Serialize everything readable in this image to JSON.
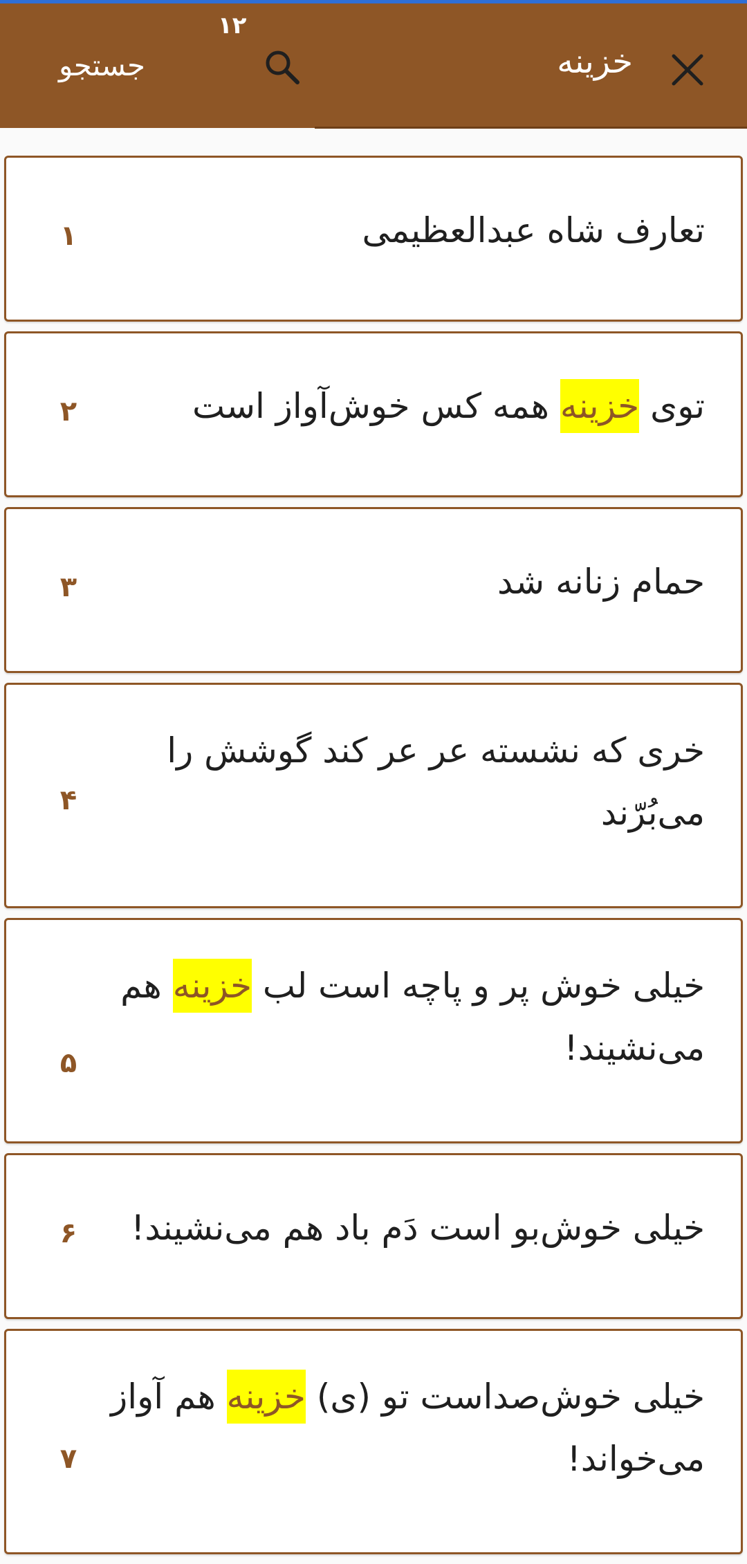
{
  "app_bar": {
    "query": "خزینه",
    "result_count": "۱۲",
    "search_label": "جستجو",
    "close_icon": "close-icon",
    "search_icon": "search-icon",
    "background_color": "#8e5626"
  },
  "highlight": {
    "term": "خزینه",
    "background_color": "#ffff00"
  },
  "results": [
    {
      "number": "۱",
      "text": "تعارف شاه عبدالعظیمی"
    },
    {
      "number": "۲",
      "text": "توی خزینه همه کس خوش‌آواز است"
    },
    {
      "number": "۳",
      "text": "حمام زنانه شد"
    },
    {
      "number": "۴",
      "text": "خری که نشسته عر عر کند گوشش را می‌بُرّند"
    },
    {
      "number": "۵",
      "text": "خیلی خوش پر و پاچه است لب خزینه هم می‌نشیند!"
    },
    {
      "number": "۶",
      "text": "خیلی خوش‌بو است دَم باد هم می‌نشیند!"
    },
    {
      "number": "۷",
      "text": "خیلی خوش‌صداست تو (ی) خزینه هم آواز می‌خواند!"
    }
  ]
}
